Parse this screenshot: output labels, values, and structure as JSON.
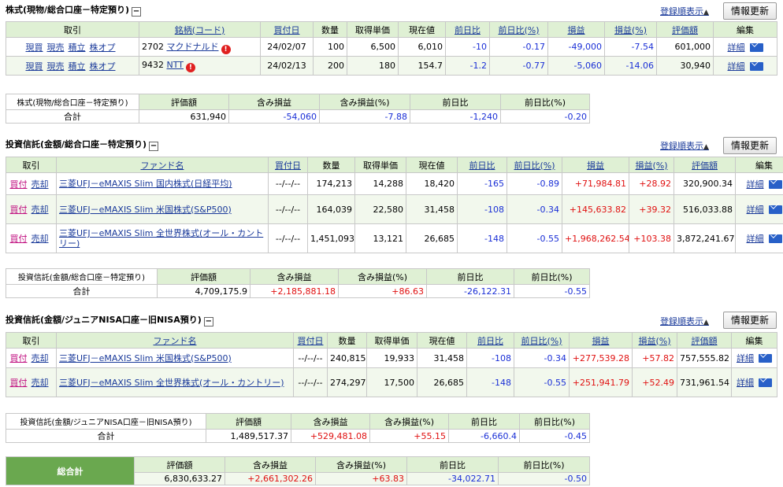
{
  "common": {
    "sort_label": "登録順表示",
    "refresh_label": "情報更新",
    "detail_label": "詳細",
    "toggle_label": "−"
  },
  "stocks": {
    "title": "株式(現物/総合口座－特定預り)",
    "headers": [
      "取引",
      "銘柄(コード)",
      "買付日",
      "数量",
      "取得単価",
      "現在値",
      "前日比",
      "前日比(%)",
      "損益",
      "損益(%)",
      "評価額",
      "編集"
    ],
    "actions": [
      "現買",
      "現売",
      "積立",
      "株オプ"
    ],
    "rows": [
      {
        "code": "2702",
        "name": "マクドナルド",
        "date": "24/02/07",
        "qty": "100",
        "cost": "6,500",
        "price": "6,010",
        "chg": "-10",
        "chg_pct": "-0.17",
        "pl": "-49,000",
        "pl_pct": "-7.54",
        "value": "601,000"
      },
      {
        "code": "9432",
        "name": "NTT",
        "date": "24/02/13",
        "qty": "200",
        "cost": "180",
        "price": "154.7",
        "chg": "-1.2",
        "chg_pct": "-0.77",
        "pl": "-5,060",
        "pl_pct": "-14.06",
        "value": "30,940"
      }
    ],
    "summary": {
      "label": "株式(現物/総合口座－特定預り)",
      "total_label": "合計",
      "headers": [
        "評価額",
        "含み損益",
        "含み損益(%)",
        "前日比",
        "前日比(%)"
      ],
      "values": [
        "631,940",
        "-54,060",
        "-7.88",
        "-1,240",
        "-0.20"
      ]
    }
  },
  "funds1": {
    "title": "投資信託(金額/総合口座－特定預り)",
    "headers": [
      "取引",
      "ファンド名",
      "買付日",
      "数量",
      "取得単価",
      "現在値",
      "前日比",
      "前日比(%)",
      "損益",
      "損益(%)",
      "評価額",
      "編集"
    ],
    "actions": [
      "買付",
      "売却"
    ],
    "rows": [
      {
        "name": "三菱UFJ－eMAXIS Slim 国内株式(日経平均)",
        "date": "--/--/--",
        "qty": "174,213",
        "cost": "14,288",
        "price": "18,420",
        "chg": "-165",
        "chg_pct": "-0.89",
        "pl": "+71,984.81",
        "pl_pct": "+28.92",
        "value": "320,900.34"
      },
      {
        "name": "三菱UFJ－eMAXIS Slim 米国株式(S&P500)",
        "date": "--/--/--",
        "qty": "164,039",
        "cost": "22,580",
        "price": "31,458",
        "chg": "-108",
        "chg_pct": "-0.34",
        "pl": "+145,633.82",
        "pl_pct": "+39.32",
        "value": "516,033.88"
      },
      {
        "name": "三菱UFJ－eMAXIS Slim 全世界株式(オール・カントリー)",
        "date": "--/--/--",
        "qty": "1,451,093",
        "cost": "13,121",
        "price": "26,685",
        "chg": "-148",
        "chg_pct": "-0.55",
        "pl": "+1,968,262.54",
        "pl_pct": "+103.38",
        "value": "3,872,241.67"
      }
    ],
    "summary": {
      "label": "投資信託(金額/総合口座－特定預り)",
      "total_label": "合計",
      "headers": [
        "評価額",
        "含み損益",
        "含み損益(%)",
        "前日比",
        "前日比(%)"
      ],
      "values": [
        "4,709,175.9",
        "+2,185,881.18",
        "+86.63",
        "-26,122.31",
        "-0.55"
      ]
    }
  },
  "funds2": {
    "title": "投資信託(金額/ジュニアNISA口座－旧NISA預り)",
    "headers": [
      "取引",
      "ファンド名",
      "買付日",
      "数量",
      "取得単価",
      "現在値",
      "前日比",
      "前日比(%)",
      "損益",
      "損益(%)",
      "評価額",
      "編集"
    ],
    "actions": [
      "買付",
      "売却"
    ],
    "rows": [
      {
        "name": "三菱UFJ－eMAXIS Slim 米国株式(S&P500)",
        "date": "--/--/--",
        "qty": "240,815",
        "cost": "19,933",
        "price": "31,458",
        "chg": "-108",
        "chg_pct": "-0.34",
        "pl": "+277,539.28",
        "pl_pct": "+57.82",
        "value": "757,555.82"
      },
      {
        "name": "三菱UFJ－eMAXIS Slim 全世界株式(オール・カントリー)",
        "date": "--/--/--",
        "qty": "274,297",
        "cost": "17,500",
        "price": "26,685",
        "chg": "-148",
        "chg_pct": "-0.55",
        "pl": "+251,941.79",
        "pl_pct": "+52.49",
        "value": "731,961.54"
      }
    ],
    "summary": {
      "label": "投資信託(金額/ジュニアNISA口座－旧NISA預り)",
      "total_label": "合計",
      "headers": [
        "評価額",
        "含み損益",
        "含み損益(%)",
        "前日比",
        "前日比(%)"
      ],
      "values": [
        "1,489,517.37",
        "+529,481.08",
        "+55.15",
        "-6,660.4",
        "-0.45"
      ]
    }
  },
  "grand_total": {
    "label": "総合計",
    "headers": [
      "評価額",
      "含み損益",
      "含み損益(%)",
      "前日比",
      "前日比(%)"
    ],
    "values": [
      "6,830,633.27",
      "+2,661,302.26",
      "+63.83",
      "-34,022.71",
      "-0.50"
    ]
  }
}
